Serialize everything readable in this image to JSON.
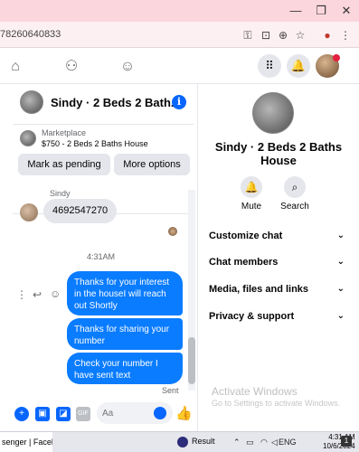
{
  "browser": {
    "url_fragment": "78260640833",
    "window_controls": [
      "minimize",
      "restore",
      "close"
    ],
    "toolbar_icons": [
      "key-icon",
      "screencast-icon",
      "zoom-icon",
      "star-icon",
      "profile-icon",
      "menu-icon"
    ]
  },
  "fb_nav": {
    "icons": [
      "home-icon",
      "friends-icon",
      "groups-icon"
    ],
    "right_icons": [
      "menu-grid-icon",
      "notifications-icon",
      "avatar"
    ]
  },
  "chat": {
    "header_title": "Sindy · 2 Beds 2 Bath...",
    "listing": {
      "label": "Marketplace",
      "price_title": "$750 - 2 Beds 2 Baths House",
      "mark_pending": "Mark as pending",
      "more_options": "More options"
    },
    "sender_name": "Sindy",
    "incoming_message": "4692547270",
    "timestamp": "4:31AM",
    "outgoing_messages": [
      "Thanks for your interest in the houseI will reach out Shortly",
      "Thanks  for  sharing your number",
      "Check your number  I have  sent text"
    ],
    "sent_status": "Sent",
    "composer_placeholder": "Aa"
  },
  "details": {
    "title": "Sindy · 2 Beds 2 Baths House",
    "actions": [
      {
        "label": "Mute",
        "icon": "bell-icon"
      },
      {
        "label": "Search",
        "icon": "search-icon"
      }
    ],
    "sections": [
      "Customize chat",
      "Chat members",
      "Media, files and links",
      "Privacy & support"
    ]
  },
  "watermark": {
    "line1": "Activate Windows",
    "line2": "Go to Settings to activate Windows."
  },
  "taskbar": {
    "active_tab": "senger | Faceboo...",
    "result_label": "Result",
    "lang": "ENG",
    "time": "4:31 AM",
    "date": "10/6/2024"
  },
  "colors": {
    "accent": "#0866ff",
    "bubble_out": "#0a7cff",
    "titlebar": "#fbd6dd"
  }
}
